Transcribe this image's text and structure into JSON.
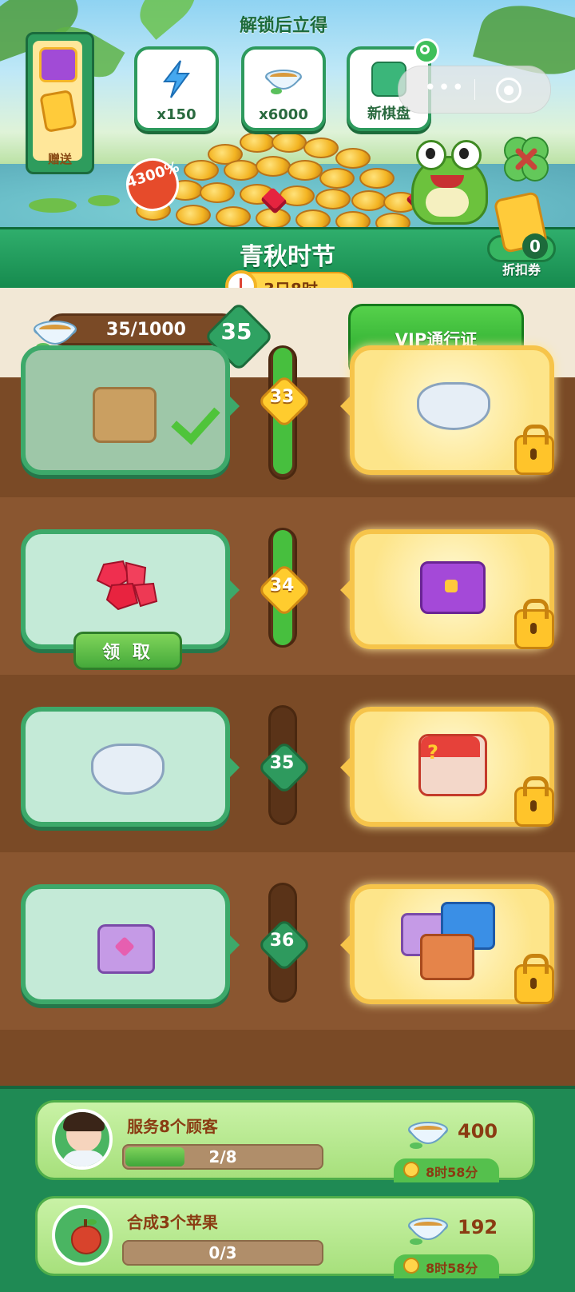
{
  "banner": {
    "unlock_title": "解锁后立得",
    "gift_label": "赠送",
    "rewards": [
      {
        "label": "x150",
        "icon": "lightning-icon"
      },
      {
        "label": "x6000",
        "icon": "tea-bowl-icon"
      },
      {
        "label": "新棋盘",
        "icon": "board-icon"
      }
    ],
    "percent_badge": "4300%"
  },
  "season": {
    "title": "青秋时节",
    "timer": "3日8时"
  },
  "discount": {
    "count": "0",
    "label": "折扣券"
  },
  "progress": {
    "xp_text": "35/1000",
    "level": "35",
    "vip_button": "VIP通行证"
  },
  "rows": [
    {
      "level": "33",
      "free_item": "mystery-box-icon",
      "vip_item": "shell-bowl-icon",
      "status": "claimed"
    },
    {
      "level": "34",
      "free_item": "ruby-gems-icon",
      "vip_item": "purple-chest-icon",
      "status": "claimable",
      "claim_label": "领 取"
    },
    {
      "level": "35",
      "free_item": "shell-bowl-icon",
      "vip_item": "red-mystery-box-icon",
      "status": "locked"
    },
    {
      "level": "36",
      "free_item": "purple-chest-icon",
      "vip_item": "chest-bundle-icon",
      "status": "locked"
    }
  ],
  "tasks": [
    {
      "title": "服务8个顾客",
      "progress_text": "2/8",
      "progress": 0.25,
      "reward": "400",
      "time": "8时58分"
    },
    {
      "title": "合成3个苹果",
      "progress_text": "0/3",
      "progress": 0,
      "reward": "192",
      "time": "8时58分"
    }
  ],
  "colors": {
    "accent_green": "#2fae6c",
    "gold": "#ffcc2e",
    "wood": "#7a4a26"
  }
}
